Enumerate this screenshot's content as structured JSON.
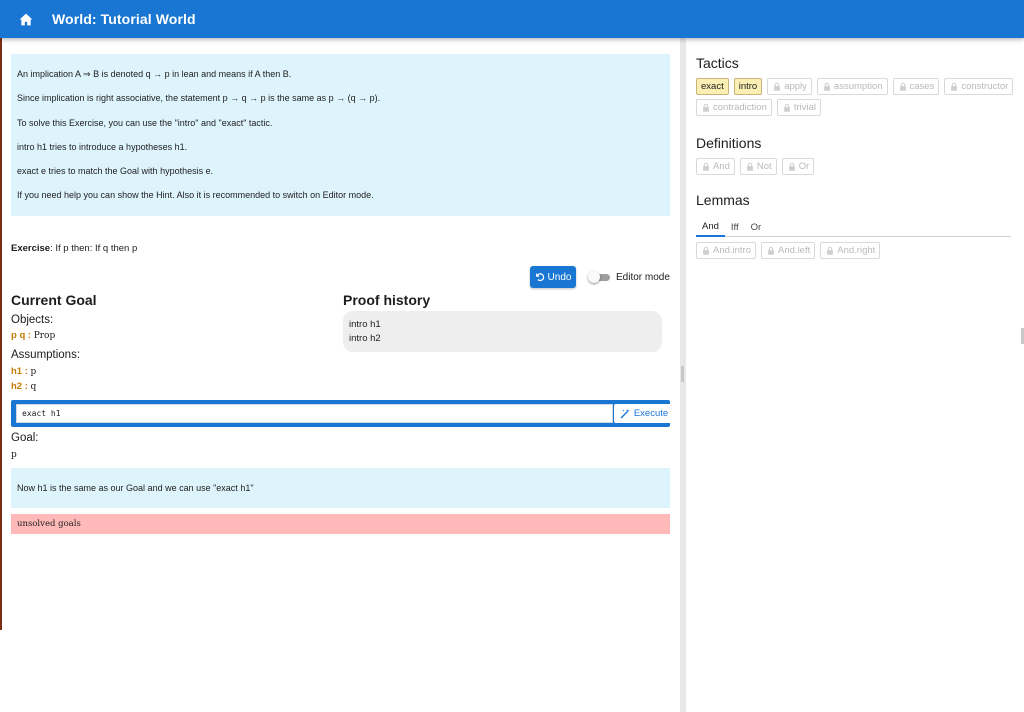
{
  "header": {
    "title": "World: Tutorial World",
    "home_icon": "home-icon",
    "color": "#1976d2"
  },
  "level": {
    "intro_paragraphs": [
      "An implication A ⇒ B is denoted q → p in lean and means if A then B.",
      "Since implication is right associative, the statement p → q → p is the same as p → (q → p).",
      "To solve this Exercise, you can use the \"intro\" and \"exact\" tactic.",
      "intro h1 tries to introduce a hypotheses h1.",
      "exact e tries to match the Goal with hypothesis e.",
      "If you need help you can show the Hint. Also it is recommended to switch on Editor mode."
    ],
    "exercise_label": "Exercise",
    "exercise_text": ": If p then: If q then p"
  },
  "controls": {
    "undo_label": "Undo",
    "undo_icon": "undo-icon",
    "editor_mode_label": "Editor mode",
    "editor_mode_on": false
  },
  "goal": {
    "heading": "Current Goal",
    "objects_label": "Objects:",
    "objects_names": "p q",
    "objects_sep": " : ",
    "objects_type": "Prop",
    "assumptions_label": "Assumptions:",
    "assumptions": [
      {
        "name": "h1",
        "sep": " : ",
        "type": "p"
      },
      {
        "name": "h2",
        "sep": " : ",
        "type": "q"
      }
    ],
    "goal_label": "Goal:",
    "goal_value": "p"
  },
  "history": {
    "heading": "Proof history",
    "items": [
      "intro h1",
      "intro h2"
    ]
  },
  "command": {
    "value": "exact h1",
    "execute_label": "Execute",
    "execute_icon": "magic-wand-icon"
  },
  "hint_text": "Now h1 is the same as our Goal and we can use \"exact h1\"",
  "error_text": "unsolved goals",
  "sidebar": {
    "tactics_heading": "Tactics",
    "tactics": [
      {
        "label": "exact",
        "locked": false
      },
      {
        "label": "intro",
        "locked": false
      },
      {
        "label": "apply",
        "locked": true
      },
      {
        "label": "assumption",
        "locked": true
      },
      {
        "label": "cases",
        "locked": true
      },
      {
        "label": "constructor",
        "locked": true
      },
      {
        "label": "contradiction",
        "locked": true
      },
      {
        "label": "trivial",
        "locked": true
      }
    ],
    "definitions_heading": "Definitions",
    "definitions": [
      {
        "label": "And",
        "locked": true
      },
      {
        "label": "Not",
        "locked": true
      },
      {
        "label": "Or",
        "locked": true
      }
    ],
    "lemmas_heading": "Lemmas",
    "lemma_tabs": [
      "And",
      "Iff",
      "Or"
    ],
    "active_lemma_tab": "And",
    "lemmas": [
      {
        "label": "And.intro",
        "locked": true
      },
      {
        "label": "And.left",
        "locked": true
      },
      {
        "label": "And.right",
        "locked": true
      }
    ]
  },
  "colors": {
    "primary": "#1976d2",
    "info_bg": "#def4fc",
    "error_bg": "#ffb9b9",
    "hypothesis_name": "#c77c02",
    "unlocked_chip": "#fcefb4"
  }
}
